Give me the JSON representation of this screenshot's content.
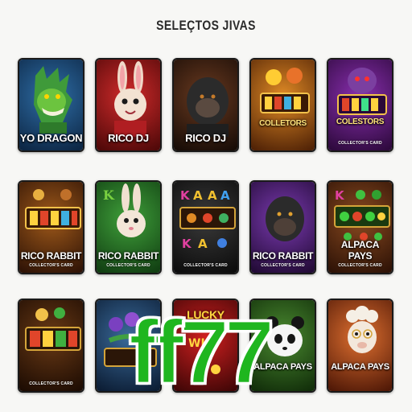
{
  "page": {
    "title": "SELEÇTOS JIVAS"
  },
  "colors": {
    "background": "#f7f7f5",
    "watermark": "#1fb61f"
  },
  "cards": [
    {
      "label": "YO DRAGON",
      "sub": "",
      "theme": "dragon"
    },
    {
      "label": "RICO DJ",
      "sub": "",
      "theme": "rabbit-red"
    },
    {
      "label": "RICO DJ",
      "sub": "",
      "theme": "gorilla-dark"
    },
    {
      "label": "COLLETORS",
      "sub": "",
      "theme": "gold-slot"
    },
    {
      "label": "COLESTORS",
      "sub": "COLLECTOR'S CARD",
      "theme": "purple-slot"
    },
    {
      "label": "RICO RABBIT",
      "sub": "COLLECTOR'S CARD",
      "theme": "brown-slot"
    },
    {
      "label": "RICO RABBIT",
      "sub": "COLLECTOR'S CARD",
      "theme": "rabbit-green"
    },
    {
      "label": "",
      "sub": "COLLECTOR'S CARD",
      "theme": "letters-slot"
    },
    {
      "label": "RICO RABBIT",
      "sub": "COLLECTOR'S CARD",
      "theme": "gorilla-purple"
    },
    {
      "label": "ALPACA PAYS",
      "sub": "COLLECTOR'S CARD",
      "theme": "gem-slot"
    },
    {
      "label": "",
      "sub": "COLLECTOR'S CARD",
      "theme": "gold-reels"
    },
    {
      "label": "",
      "sub": "",
      "theme": "flower-slot"
    },
    {
      "label": "LUCKY",
      "sub": "",
      "theme": "lucky"
    },
    {
      "label": "ALPACA PAYS",
      "sub": "",
      "theme": "panda"
    },
    {
      "label": "ALPACA PAYS",
      "sub": "",
      "theme": "alpaca"
    }
  ],
  "watermark": {
    "text": "ff77"
  }
}
